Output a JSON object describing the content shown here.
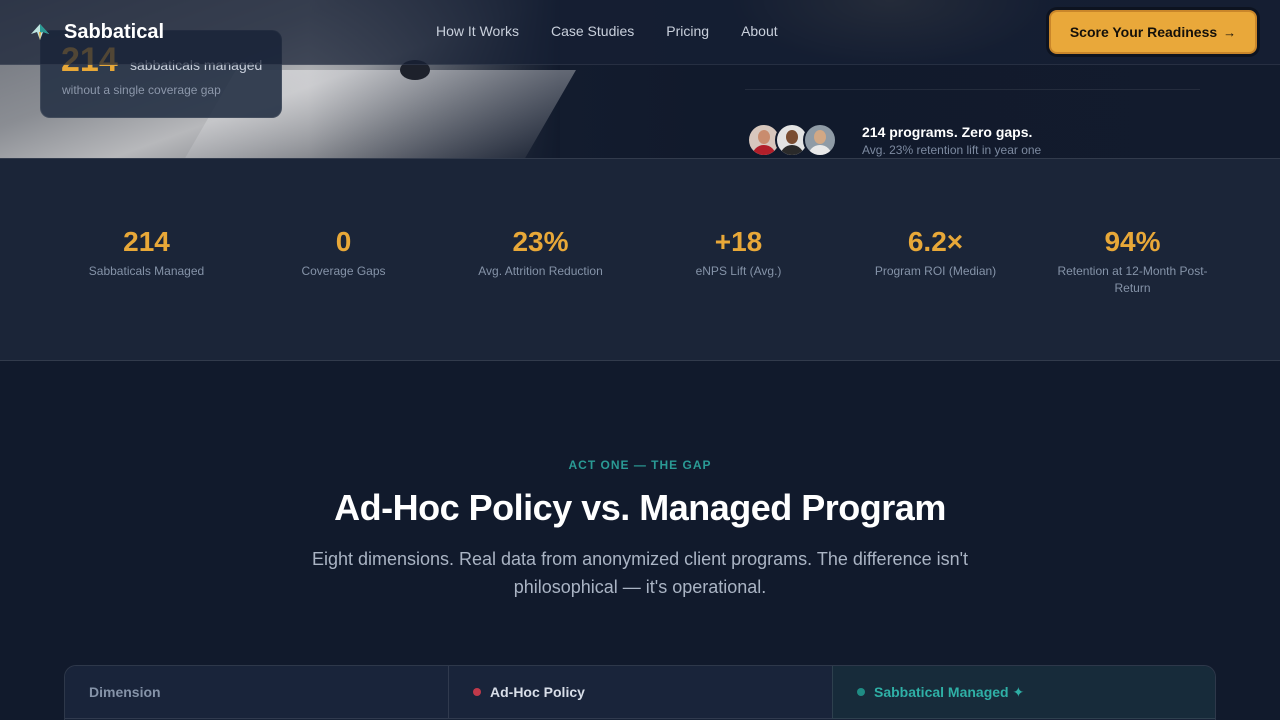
{
  "brand": {
    "name": "Sabbatical"
  },
  "nav": {
    "links": [
      "How It Works",
      "Case Studies",
      "Pricing",
      "About"
    ],
    "cta_label": "Score Your Readiness",
    "cta_arrow": "→"
  },
  "hero": {
    "card_number": "214",
    "card_label": "sabbaticals managed",
    "card_sub": "without a single coverage gap",
    "proof_title": "214 programs. Zero gaps.",
    "proof_sub": "Avg. 23% retention lift in year one"
  },
  "stats": [
    {
      "value": "214",
      "label": "Sabbaticals Managed"
    },
    {
      "value": "0",
      "label": "Coverage Gaps"
    },
    {
      "value": "23%",
      "label": "Avg. Attrition Reduction"
    },
    {
      "value": "+18",
      "label": "eNPS Lift (Avg.)"
    },
    {
      "value": "6.2×",
      "label": "Program ROI (Median)"
    },
    {
      "value": "94%",
      "label": "Retention at 12-Month Post-Return"
    }
  ],
  "section": {
    "eyebrow": "ACT ONE — THE GAP",
    "title": "Ad-Hoc Policy vs. Managed Program",
    "lede": "Eight dimensions. Real data from anonymized client programs. The difference isn't philosophical — it's operational."
  },
  "table": {
    "headers": [
      "Dimension",
      "Ad-Hoc Policy",
      "Sabbatical Managed ✦"
    ]
  },
  "colors": {
    "accent": "#e8a838",
    "teal": "#2a9a94",
    "background": "#111a2c",
    "adhoc_dot": "#c0394a"
  }
}
